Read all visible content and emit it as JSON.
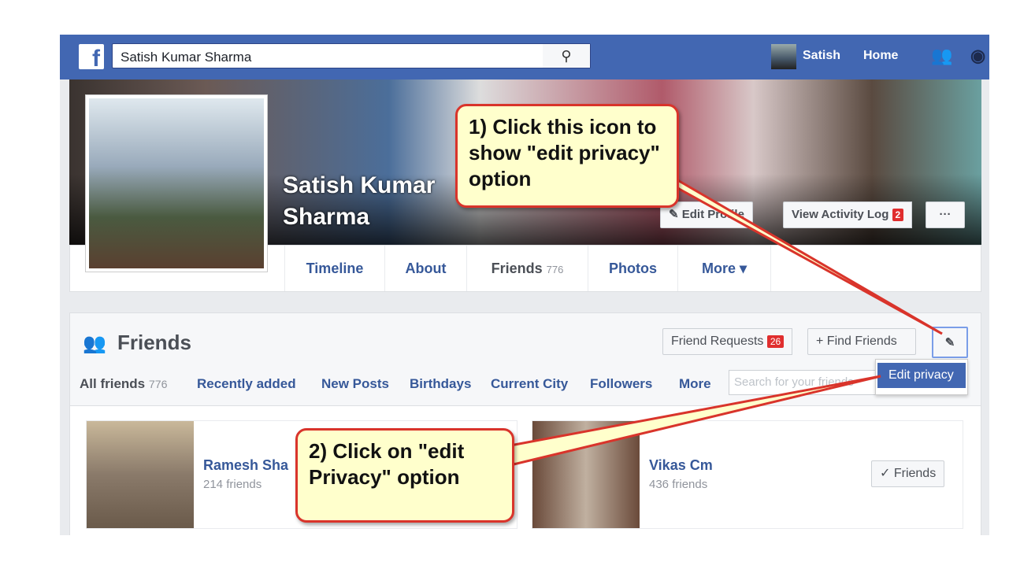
{
  "topbar": {
    "search_value": "Satish Kumar Sharma",
    "user": "Satish",
    "home": "Home"
  },
  "profile": {
    "name_line1": "Satish Kumar",
    "name_line2": "Sharma",
    "edit_profile": "Edit Profile",
    "activity_log": "View Activity Log",
    "activity_badge": "2",
    "more_dots": "···"
  },
  "tabs": [
    {
      "label": "Timeline"
    },
    {
      "label": "About"
    },
    {
      "label": "Friends",
      "count": "776"
    },
    {
      "label": "Photos"
    },
    {
      "label": "More ▾"
    }
  ],
  "friends": {
    "title": "Friends",
    "friend_requests": "Friend Requests",
    "requests_badge": "26",
    "find_friends": "+ Find Friends",
    "edit_icon": "pencil-icon",
    "menu_item": "Edit privacy",
    "subtabs": [
      {
        "label": "All friends",
        "count": "776"
      },
      {
        "label": "Recently added"
      },
      {
        "label": "New Posts"
      },
      {
        "label": "Birthdays"
      },
      {
        "label": "Current City"
      },
      {
        "label": "Followers"
      },
      {
        "label": "More"
      }
    ],
    "search_placeholder": "Search for your friends",
    "list": [
      {
        "name": "Ramesh Sha",
        "count": "214 friends"
      },
      {
        "name": "Vikas Cm",
        "count": "436 friends",
        "button": "✓ Friends"
      }
    ]
  },
  "callouts": {
    "one": "1) Click this icon to show \"edit privacy\" option",
    "two": "2) Click on \"edit Privacy\" option"
  },
  "colors": {
    "brand": "#4267b2",
    "callout_bg": "#ffffcc",
    "callout_border": "#d9342b"
  }
}
